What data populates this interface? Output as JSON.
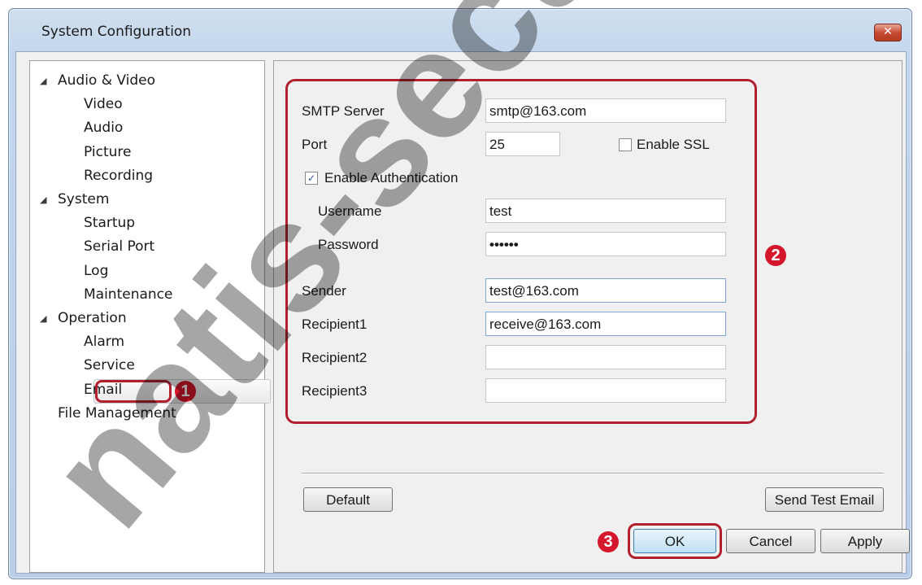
{
  "window": {
    "title": "System Configuration",
    "close_glyph": "✕"
  },
  "tree": {
    "items": [
      {
        "label": "Audio & Video",
        "expanded": true
      },
      {
        "label": "Video"
      },
      {
        "label": "Audio"
      },
      {
        "label": "Picture"
      },
      {
        "label": "Recording"
      },
      {
        "label": "System",
        "expanded": true
      },
      {
        "label": "Startup"
      },
      {
        "label": "Serial Port"
      },
      {
        "label": "Log"
      },
      {
        "label": "Maintenance"
      },
      {
        "label": "Operation",
        "expanded": true
      },
      {
        "label": "Alarm"
      },
      {
        "label": "Service"
      },
      {
        "label": "Email",
        "selected": true
      },
      {
        "label": "File Management"
      }
    ],
    "expand_glyph": "◢"
  },
  "form": {
    "smtp_server": {
      "label": "SMTP Server",
      "value": "smtp@163.com"
    },
    "port": {
      "label": "Port",
      "value": "25"
    },
    "enable_ssl": {
      "label": "Enable SSL",
      "checked": false
    },
    "enable_auth": {
      "label": "Enable Authentication",
      "checked": true,
      "check_glyph": "✓"
    },
    "username": {
      "label": "Username",
      "value": "test"
    },
    "password": {
      "label": "Password",
      "value": "••••••"
    },
    "sender": {
      "label": "Sender",
      "value": "test@163.com"
    },
    "recipient1": {
      "label": "Recipient1",
      "value": "receive@163.com"
    },
    "recipient2": {
      "label": "Recipient2",
      "value": ""
    },
    "recipient3": {
      "label": "Recipient3",
      "value": ""
    }
  },
  "buttons": {
    "default": "Default",
    "send_test_email": "Send Test Email",
    "ok": "OK",
    "cancel": "Cancel",
    "apply": "Apply"
  },
  "callouts": {
    "one": "1",
    "two": "2",
    "three": "3"
  },
  "watermark": {
    "text": "natis-security.com",
    "color": "#000000"
  },
  "colors": {
    "highlight": "#b0202d",
    "badge": "#d4172a"
  }
}
